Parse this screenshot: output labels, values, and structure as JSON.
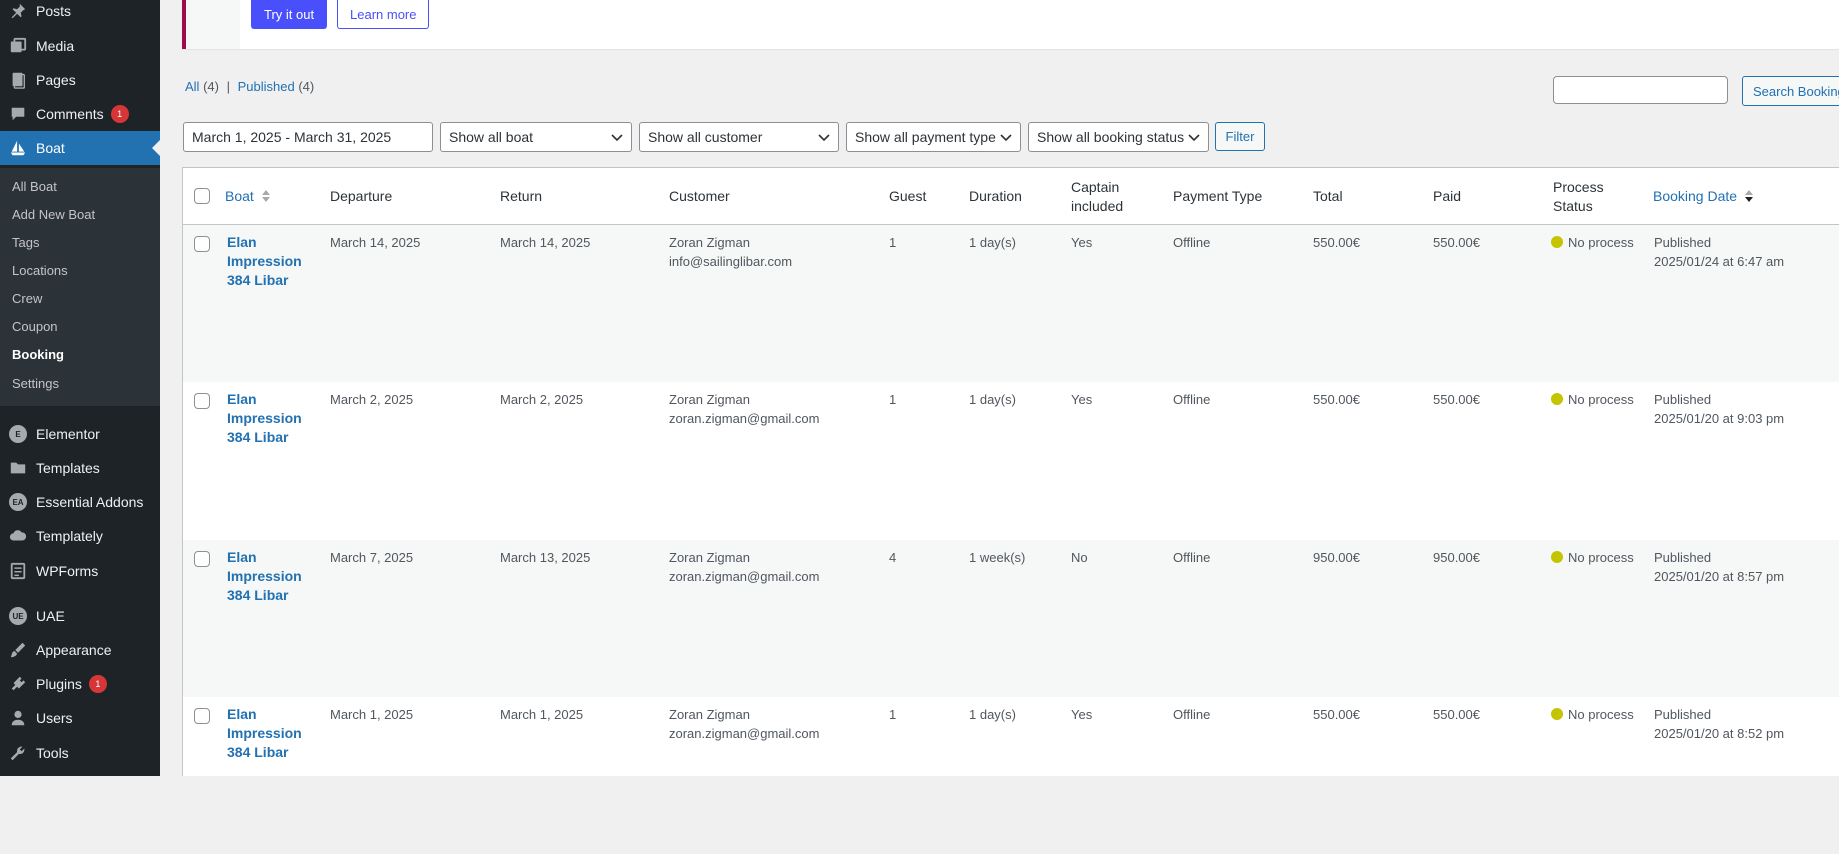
{
  "sidebar": {
    "menu": [
      {
        "label": "Posts",
        "icon": "pin-icon"
      },
      {
        "label": "Media",
        "icon": "media-icon"
      },
      {
        "label": "Pages",
        "icon": "page-icon"
      },
      {
        "label": "Comments",
        "icon": "comment-icon",
        "badge": "1"
      },
      {
        "label": "Boat",
        "icon": "sailboat-icon",
        "current": true
      },
      {
        "label": "Elementor",
        "icon": "elementor-icon"
      },
      {
        "label": "Templates",
        "icon": "folder-icon"
      },
      {
        "label": "Essential Addons",
        "icon": "ea-icon"
      },
      {
        "label": "Templately",
        "icon": "cloud-icon"
      },
      {
        "label": "WPForms",
        "icon": "form-icon"
      },
      {
        "label": "UAE",
        "icon": "uae-icon"
      },
      {
        "label": "Appearance",
        "icon": "brush-icon"
      },
      {
        "label": "Plugins",
        "icon": "plugin-icon",
        "badge": "1"
      },
      {
        "label": "Users",
        "icon": "user-icon"
      },
      {
        "label": "Tools",
        "icon": "wrench-icon"
      }
    ],
    "submenu": [
      "All Boat",
      "Add New Boat",
      "Tags",
      "Locations",
      "Crew",
      "Coupon",
      "Booking",
      "Settings"
    ],
    "submenu_current": "Booking"
  },
  "notice": {
    "try_label": "Try it out",
    "learn_label": "Learn more"
  },
  "views": {
    "all_label": "All",
    "all_count": "(4)",
    "separator": "|",
    "published_label": "Published",
    "published_count": "(4)"
  },
  "search": {
    "value": "",
    "button_label": "Search Booking"
  },
  "filters": {
    "date_range": "March 1, 2025 - March 31, 2025",
    "boat": "Show all boat",
    "customer": "Show all customer",
    "payment_type": "Show all payment type",
    "booking_status": "Show all booking status",
    "button_label": "Filter"
  },
  "table": {
    "headers": {
      "boat": "Boat",
      "departure": "Departure",
      "return": "Return",
      "customer": "Customer",
      "guest": "Guest",
      "duration": "Duration",
      "captain_1": "Captain",
      "captain_2": "included",
      "payment_type": "Payment Type",
      "total": "Total",
      "paid": "Paid",
      "process_1": "Process",
      "process_2": "Status",
      "booking_date": "Booking Date"
    },
    "rows": [
      {
        "boat": [
          "Elan",
          "Impression",
          "384 Libar"
        ],
        "departure": "March 14, 2025",
        "return": "March 14, 2025",
        "customer_name": "Zoran Zigman",
        "customer_email": "info@sailinglibar.com",
        "guest": "1",
        "duration": "1 day(s)",
        "captain": "Yes",
        "payment_type": "Offline",
        "total": "550.00€",
        "paid": "550.00€",
        "process": "No process",
        "status": "Published",
        "date": "2025/01/24 at 6:47 am"
      },
      {
        "boat": [
          "Elan",
          "Impression",
          "384 Libar"
        ],
        "departure": "March 2, 2025",
        "return": "March 2, 2025",
        "customer_name": "Zoran Zigman",
        "customer_email": "zoran.zigman@gmail.com",
        "guest": "1",
        "duration": "1 day(s)",
        "captain": "Yes",
        "payment_type": "Offline",
        "total": "550.00€",
        "paid": "550.00€",
        "process": "No process",
        "status": "Published",
        "date": "2025/01/20 at 9:03 pm"
      },
      {
        "boat": [
          "Elan",
          "Impression",
          "384 Libar"
        ],
        "departure": "March 7, 2025",
        "return": "March 13, 2025",
        "customer_name": "Zoran Zigman",
        "customer_email": "zoran.zigman@gmail.com",
        "guest": "4",
        "duration": "1 week(s)",
        "captain": "No",
        "payment_type": "Offline",
        "total": "950.00€",
        "paid": "950.00€",
        "process": "No process",
        "status": "Published",
        "date": "2025/01/20 at 8:57 pm"
      },
      {
        "boat": [
          "Elan",
          "Impression",
          "384 Libar"
        ],
        "departure": "March 1, 2025",
        "return": "March 1, 2025",
        "customer_name": "Zoran Zigman",
        "customer_email": "zoran.zigman@gmail.com",
        "guest": "1",
        "duration": "1 day(s)",
        "captain": "Yes",
        "payment_type": "Offline",
        "total": "550.00€",
        "paid": "550.00€",
        "process": "No process",
        "status": "Published",
        "date": "2025/01/20 at 8:52 pm"
      }
    ]
  },
  "colors": {
    "sidebar_bg": "#1d2327",
    "accent": "#2271b1",
    "notice_button": "#4950fb",
    "badge": "#d63638",
    "process_dot": "#c5c400"
  }
}
